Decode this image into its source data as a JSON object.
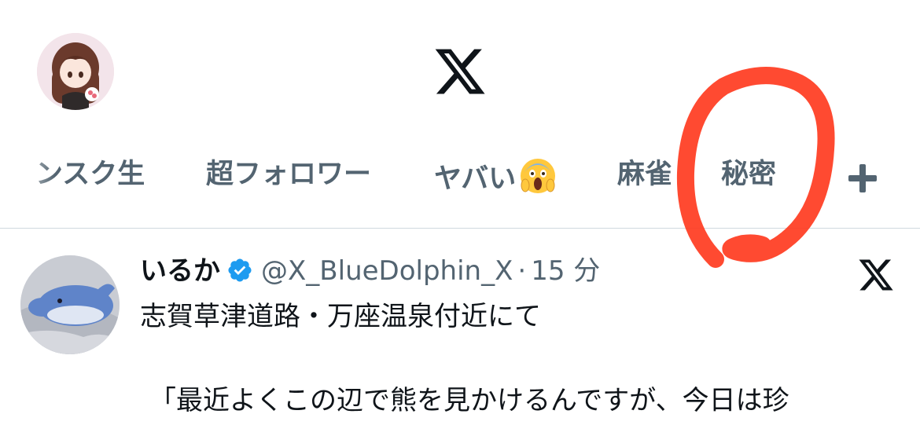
{
  "header": {
    "logo_icon": "x-logo-icon"
  },
  "tabs": [
    {
      "label": "ンスク生"
    },
    {
      "label": "超フォロワー"
    },
    {
      "label": "ヤバい",
      "emoji": "screaming-face-emoji"
    },
    {
      "label": "麻雀"
    },
    {
      "label": "秘密"
    }
  ],
  "add_tab_icon": "plus-icon",
  "tweet": {
    "name": "いるか",
    "verified_icon": "verified-badge-icon",
    "handle": "@X_BlueDolphin_X",
    "separator": "·",
    "time": "15 分",
    "line1": "志賀草津道路・万座温泉付近にて",
    "line2": "「最近よくこの辺で熊を見かけるんですが、今日は珍"
  },
  "colors": {
    "accent": "#1d9bf0",
    "muted": "#536471",
    "annotation": "#ff3b1f"
  }
}
